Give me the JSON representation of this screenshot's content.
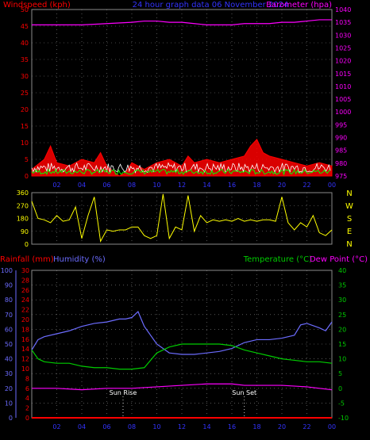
{
  "header": {
    "left_label": "Windspeed (kph)",
    "center_label": "24 hour graph data  06 November 2024",
    "right_label": "Barometer (hpa)"
  },
  "bottom_header": {
    "rainfall_label": "Rainfall (mm)",
    "humidity_label": "Humidity (%)",
    "temperature_label": "Temperature (°C)",
    "dewpoint_label": "Dew Point (°C)"
  },
  "annotations": {
    "sunrise": "Sun Rise",
    "sunset": "Sun Set"
  },
  "compass": [
    "N",
    "W",
    "S",
    "E",
    "N"
  ],
  "colors": {
    "background": "#000000",
    "grid": "#8a8a8a",
    "wind_speed": "#ff0000",
    "wind_gust": "#ffffff",
    "wind_avg": "#00ff00",
    "barometer": "#ff00ff",
    "direction": "#ffff00",
    "rainfall": "#ff0000",
    "humidity": "#6c6cff",
    "temperature": "#00cc00",
    "dewpoint": "#ff00ff",
    "title": "#3333ff",
    "compass": "#ffff00"
  },
  "chart_data": [
    {
      "type": "area",
      "panel": "wind-barometer",
      "x_ticks": [
        "02",
        "04",
        "06",
        "08",
        "10",
        "12",
        "14",
        "16",
        "18",
        "20",
        "22",
        "00"
      ],
      "x_range_hours": [
        0,
        24
      ],
      "left_axis": {
        "ticks": [
          0,
          5,
          10,
          15,
          20,
          25,
          30,
          35,
          40,
          45,
          50
        ],
        "ylim": [
          0,
          50
        ]
      },
      "right_axis": {
        "ticks": [
          975,
          980,
          985,
          990,
          995,
          1000,
          1005,
          1010,
          1015,
          1020,
          1025,
          1030,
          1035,
          1040
        ],
        "ylim": [
          975,
          1040
        ]
      },
      "grid": true,
      "series": [
        {
          "name": "Windspeed (kph)",
          "x": [
            0,
            1,
            1.5,
            2,
            3,
            4,
            5,
            5.5,
            6,
            7,
            7.5,
            8,
            9,
            10,
            11,
            12,
            12.5,
            13,
            14,
            15,
            16,
            17,
            17.5,
            18,
            18.5,
            19,
            20,
            21,
            22,
            23,
            24
          ],
          "y": [
            2,
            5,
            9,
            4,
            3,
            5,
            4,
            7,
            3,
            0,
            1,
            4,
            2,
            4,
            5,
            3,
            6,
            4,
            5,
            4,
            5,
            6,
            9,
            11,
            7,
            6,
            5,
            4,
            3,
            4,
            3
          ]
        },
        {
          "name": "Barometer (hpa)",
          "x": [
            0,
            2,
            4,
            6,
            8,
            9,
            10,
            11,
            12,
            13,
            14,
            15,
            16,
            17,
            18,
            19,
            20,
            21,
            22,
            23,
            24
          ],
          "y": [
            1034,
            1034,
            1034,
            1034.5,
            1035,
            1035.5,
            1035.5,
            1035,
            1035,
            1034.5,
            1034,
            1034,
            1034,
            1034.5,
            1034.5,
            1034.5,
            1035,
            1035,
            1035.5,
            1036,
            1036
          ]
        }
      ]
    },
    {
      "type": "line",
      "panel": "wind-direction",
      "x_range_hours": [
        0,
        24
      ],
      "left_axis": {
        "ticks": [
          0,
          90,
          180,
          270,
          360
        ],
        "ylim": [
          0,
          360
        ]
      },
      "grid": true,
      "series": [
        {
          "name": "Wind direction",
          "x": [
            0,
            0.5,
            1,
            1.5,
            2,
            2.5,
            3,
            3.5,
            4,
            4.5,
            5,
            5.5,
            6,
            6.5,
            7,
            7.5,
            8,
            8.5,
            9,
            9.5,
            10,
            10.5,
            11,
            11.5,
            12,
            12.5,
            13,
            13.5,
            14,
            14.5,
            15,
            15.5,
            16,
            16.5,
            17,
            17.5,
            18,
            18.5,
            19,
            19.5,
            20,
            20.5,
            21,
            21.5,
            22,
            22.5,
            23,
            23.5,
            24
          ],
          "y": [
            300,
            180,
            170,
            150,
            200,
            160,
            170,
            260,
            40,
            200,
            330,
            20,
            100,
            90,
            100,
            100,
            120,
            120,
            60,
            40,
            60,
            350,
            40,
            120,
            100,
            340,
            90,
            200,
            150,
            170,
            160,
            170,
            160,
            180,
            160,
            170,
            160,
            170,
            170,
            160,
            330,
            150,
            100,
            150,
            120,
            200,
            80,
            60,
            100
          ]
        }
      ]
    },
    {
      "type": "line",
      "panel": "temperature-humidity",
      "x_ticks": [
        "02",
        "04",
        "06",
        "08",
        "10",
        "12",
        "14",
        "16",
        "18",
        "20",
        "22",
        "00"
      ],
      "x_range_hours": [
        0,
        24
      ],
      "left_outer_axis": {
        "label": "Humidity (%)",
        "ticks": [
          0,
          10,
          20,
          30,
          40,
          50,
          60,
          70,
          80,
          90,
          100
        ],
        "ylim": [
          0,
          100
        ]
      },
      "left_inner_axis": {
        "label": "Rainfall (mm)",
        "ticks": [
          0,
          2,
          4,
          6,
          8,
          10,
          12,
          14,
          16,
          18,
          20,
          22,
          24,
          26,
          28,
          30
        ],
        "ylim": [
          0,
          30
        ]
      },
      "right_axis": {
        "label": "Temperature (°C)",
        "ticks": [
          -10,
          -5,
          0,
          5,
          10,
          15,
          20,
          25,
          30,
          35,
          40
        ],
        "ylim": [
          -10,
          40
        ]
      },
      "grid": true,
      "series": [
        {
          "name": "Humidity (%)",
          "x": [
            0,
            0.5,
            1,
            2,
            3,
            4,
            5,
            6,
            7,
            7.5,
            8,
            8.5,
            9,
            10,
            11,
            12,
            13,
            14,
            15,
            16,
            17,
            18,
            19,
            20,
            21,
            21.5,
            22,
            23,
            23.5,
            24
          ],
          "y": [
            46,
            53,
            55,
            57,
            59,
            62,
            64,
            65,
            67,
            67,
            68,
            72,
            62,
            50,
            44,
            43,
            43,
            44,
            45,
            47,
            51,
            53,
            53,
            54,
            56,
            63,
            64,
            61,
            59,
            65
          ]
        },
        {
          "name": "Temperature (°C)",
          "x": [
            0,
            0.5,
            1,
            2,
            3,
            4,
            5,
            6,
            7,
            8,
            9,
            10,
            11,
            12,
            13,
            14,
            15,
            16,
            17,
            18,
            19,
            20,
            21,
            22,
            23,
            24
          ],
          "y": [
            13,
            10,
            9,
            8.5,
            8.5,
            7.5,
            7,
            7,
            6.5,
            6.5,
            7,
            12,
            14,
            15,
            15,
            15,
            15,
            14.5,
            13,
            12,
            11,
            10,
            9.5,
            9,
            9,
            8.5
          ]
        },
        {
          "name": "Dew Point (°C)",
          "x": [
            0,
            2,
            4,
            6,
            8,
            10,
            12,
            14,
            15,
            16,
            17,
            18,
            20,
            22,
            24
          ],
          "y": [
            0,
            0,
            -0.5,
            0,
            0,
            0.5,
            1,
            1.5,
            1.5,
            1.5,
            1,
            1,
            1,
            0.5,
            -0.5
          ]
        },
        {
          "name": "Rainfall (mm)",
          "x": [
            0,
            24
          ],
          "y": [
            0,
            0
          ]
        }
      ],
      "markers": [
        {
          "label": "Sun Rise",
          "x": 7.3
        },
        {
          "label": "Sun Set",
          "x": 17.0
        }
      ]
    }
  ]
}
